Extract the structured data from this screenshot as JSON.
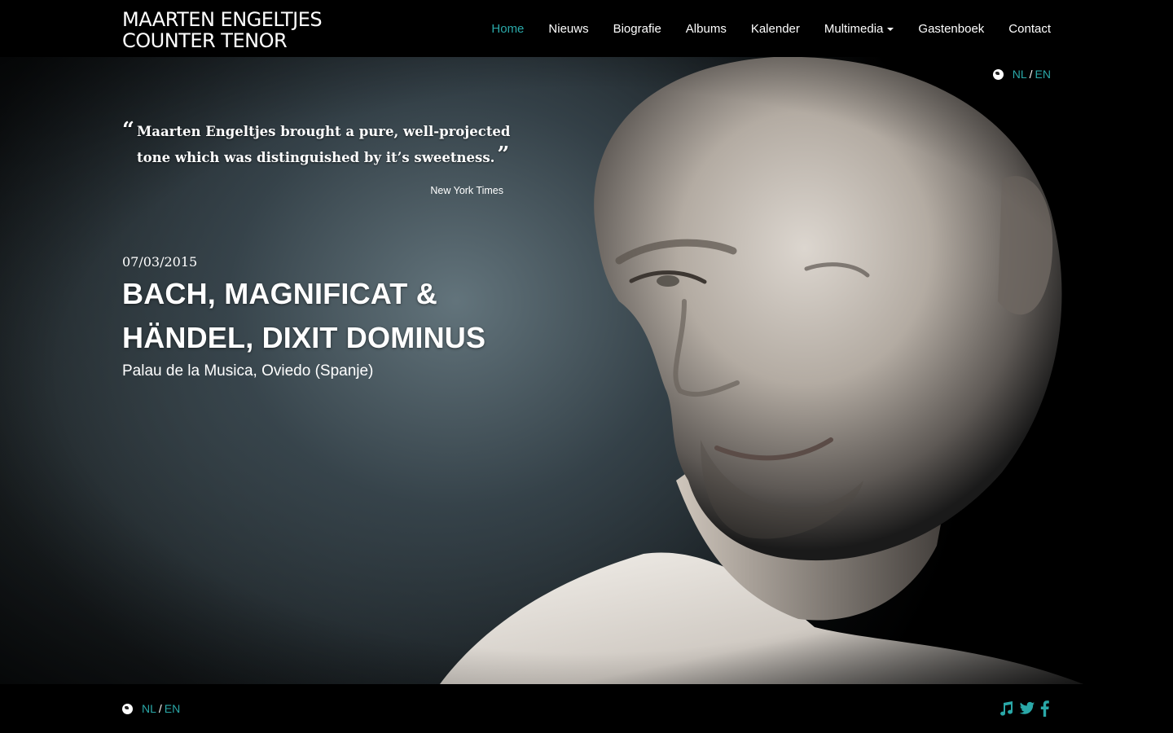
{
  "header": {
    "brand_line1": "MAARTEN ENGELTJES",
    "brand_line2": "COUNTER TENOR"
  },
  "nav": {
    "items": [
      {
        "label": "Home",
        "active": true
      },
      {
        "label": "Nieuws"
      },
      {
        "label": "Biografie"
      },
      {
        "label": "Albums"
      },
      {
        "label": "Kalender"
      },
      {
        "label": "Multimedia",
        "dropdown": true
      },
      {
        "label": "Gastenboek"
      },
      {
        "label": "Contact"
      }
    ]
  },
  "language": {
    "nl": "NL",
    "separator": "/",
    "en": "EN",
    "icon": "globe-icon"
  },
  "quote": {
    "open_mark": "“",
    "text": "Maarten Engeltjes brought a pure, well-projected tone which was distinguished by it’s sweetness.",
    "close_mark": "”",
    "source": "New York Times"
  },
  "event": {
    "date": "07/03/2015",
    "title_line1": "BACH, MAGNIFICAT &",
    "title_line2": "HÄNDEL, DIXIT DOMINUS",
    "venue": "Palau de la Musica, Oviedo (Spanje)"
  },
  "footer": {
    "social_icons": [
      "music-icon",
      "twitter-icon",
      "facebook-icon"
    ]
  },
  "colors": {
    "accent": "#2aa8a8",
    "background": "#000000",
    "text": "#ffffff"
  }
}
